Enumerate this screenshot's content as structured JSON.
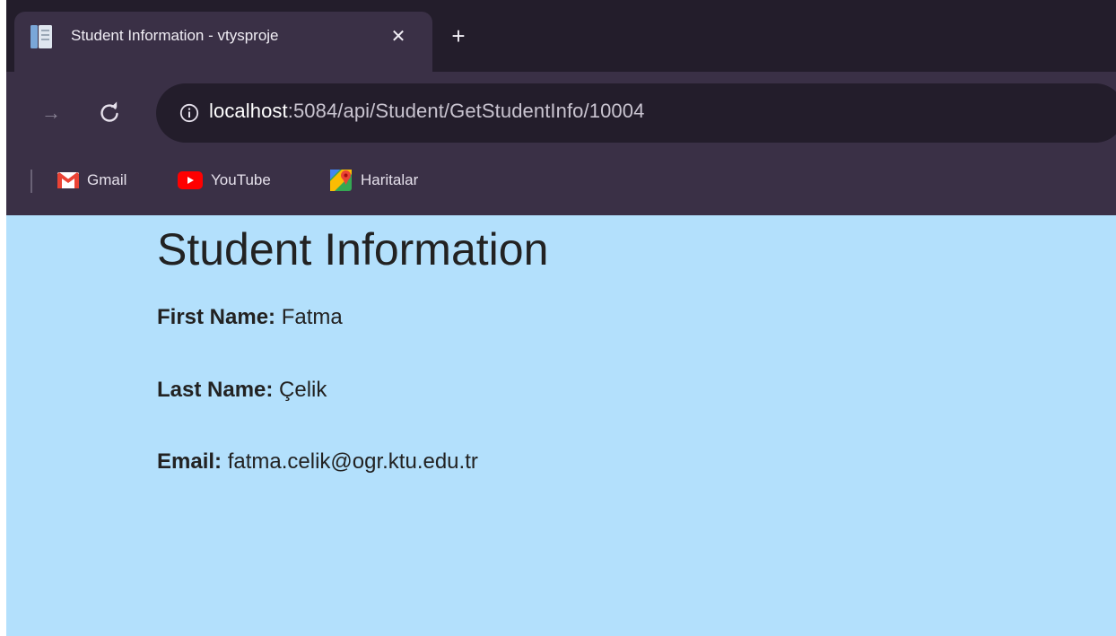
{
  "browser": {
    "tab": {
      "title": "Student Information - vtysproje",
      "close_glyph": "✕",
      "icon": "document-icon"
    },
    "new_tab_glyph": "+",
    "toolbar": {
      "forward_glyph": "→",
      "reload_icon": "reload-icon",
      "info_icon": "info-icon",
      "url_host": "localhost",
      "url_path": ":5084/api/Student/GetStudentInfo/10004"
    },
    "bookmarks": [
      {
        "label": "Gmail",
        "icon": "gmail-icon"
      },
      {
        "label": "YouTube",
        "icon": "youtube-icon"
      },
      {
        "label": "Haritalar",
        "icon": "maps-icon"
      }
    ]
  },
  "page": {
    "title": "Student Information",
    "background_color": "#b3e0fc",
    "fields": [
      {
        "label": "First Name:",
        "value": "Fatma"
      },
      {
        "label": "Last Name:",
        "value": "Çelik"
      },
      {
        "label": "Email:",
        "value": "fatma.celik@ogr.ktu.edu.tr"
      }
    ]
  }
}
